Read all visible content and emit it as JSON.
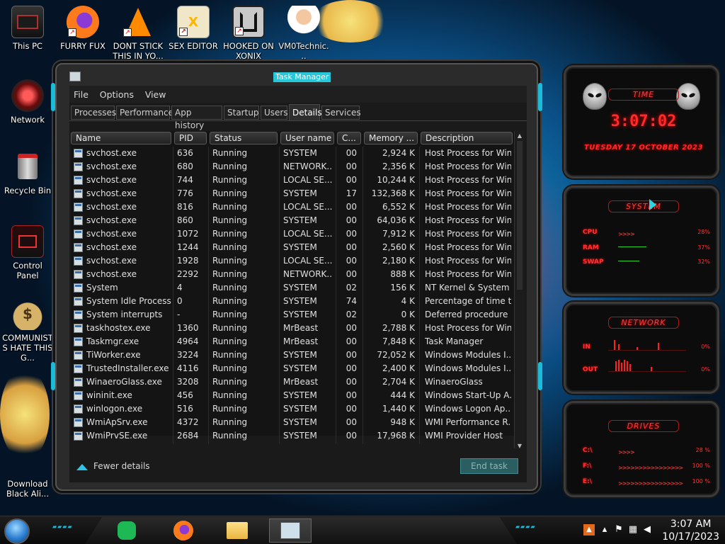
{
  "desktop": {
    "icons": [
      {
        "label": "This PC"
      },
      {
        "label": "FURRY FUX"
      },
      {
        "label": "DONT STICK THIS IN YO..."
      },
      {
        "label": "SEX EDITOR"
      },
      {
        "label": "HOOKED ON XONIX"
      },
      {
        "label": "VM0Technic..."
      },
      {
        "label": "Network"
      },
      {
        "label": "Recycle Bin"
      },
      {
        "label": "Control Panel"
      },
      {
        "label": "COMMUNISTS HATE THIS G..."
      },
      {
        "label": "Download Black Ali..."
      }
    ]
  },
  "task_manager": {
    "title": "Task Manager",
    "menu": [
      "File",
      "Options",
      "View"
    ],
    "tabs": [
      "Processes",
      "Performance",
      "App history",
      "Startup",
      "Users",
      "Details",
      "Services"
    ],
    "active_tab": "Details",
    "columns": [
      "Name",
      "PID",
      "Status",
      "User name",
      "C...",
      "Memory ...",
      "Description"
    ],
    "rows": [
      [
        "svchost.exe",
        "636",
        "Running",
        "SYSTEM",
        "00",
        "2,924 K",
        "Host Process for Win..."
      ],
      [
        "svchost.exe",
        "680",
        "Running",
        "NETWORK...",
        "00",
        "2,356 K",
        "Host Process for Win..."
      ],
      [
        "svchost.exe",
        "744",
        "Running",
        "LOCAL SE...",
        "00",
        "10,244 K",
        "Host Process for Win..."
      ],
      [
        "svchost.exe",
        "776",
        "Running",
        "SYSTEM",
        "17",
        "132,368 K",
        "Host Process for Win..."
      ],
      [
        "svchost.exe",
        "816",
        "Running",
        "LOCAL SE...",
        "00",
        "6,552 K",
        "Host Process for Win..."
      ],
      [
        "svchost.exe",
        "860",
        "Running",
        "SYSTEM",
        "00",
        "64,036 K",
        "Host Process for Win..."
      ],
      [
        "svchost.exe",
        "1072",
        "Running",
        "LOCAL SE...",
        "00",
        "7,912 K",
        "Host Process for Win..."
      ],
      [
        "svchost.exe",
        "1244",
        "Running",
        "SYSTEM",
        "00",
        "2,560 K",
        "Host Process for Win..."
      ],
      [
        "svchost.exe",
        "1928",
        "Running",
        "LOCAL SE...",
        "00",
        "2,180 K",
        "Host Process for Win..."
      ],
      [
        "svchost.exe",
        "2292",
        "Running",
        "NETWORK...",
        "00",
        "888 K",
        "Host Process for Win..."
      ],
      [
        "System",
        "4",
        "Running",
        "SYSTEM",
        "02",
        "156 K",
        "NT Kernel & System"
      ],
      [
        "System Idle Process",
        "0",
        "Running",
        "SYSTEM",
        "74",
        "4 K",
        "Percentage of time t..."
      ],
      [
        "System interrupts",
        "-",
        "Running",
        "SYSTEM",
        "02",
        "0 K",
        "Deferred procedure ..."
      ],
      [
        "taskhostex.exe",
        "1360",
        "Running",
        "MrBeast",
        "00",
        "2,788 K",
        "Host Process for Win..."
      ],
      [
        "Taskmgr.exe",
        "4964",
        "Running",
        "MrBeast",
        "00",
        "7,848 K",
        "Task Manager"
      ],
      [
        "TiWorker.exe",
        "3224",
        "Running",
        "SYSTEM",
        "00",
        "72,052 K",
        "Windows Modules I..."
      ],
      [
        "TrustedInstaller.exe",
        "4116",
        "Running",
        "SYSTEM",
        "00",
        "2,400 K",
        "Windows Modules I..."
      ],
      [
        "WinaeroGlass.exe",
        "3208",
        "Running",
        "MrBeast",
        "00",
        "2,704 K",
        "WinaeroGlass"
      ],
      [
        "wininit.exe",
        "456",
        "Running",
        "SYSTEM",
        "00",
        "444 K",
        "Windows Start-Up A..."
      ],
      [
        "winlogon.exe",
        "516",
        "Running",
        "SYSTEM",
        "00",
        "1,440 K",
        "Windows Logon Ap..."
      ],
      [
        "WmiApSrv.exe",
        "4372",
        "Running",
        "SYSTEM",
        "00",
        "948 K",
        "WMI Performance R..."
      ],
      [
        "WmiPrvSE.exe",
        "2684",
        "Running",
        "SYSTEM",
        "00",
        "17,968 K",
        "WMI Provider Host"
      ]
    ],
    "fewer_details": "Fewer details",
    "end_task": "End task"
  },
  "gadgets": {
    "time": {
      "title": "TIME",
      "clock": "3:07:02",
      "date": "TUESDAY 17 OCTOBER 2023"
    },
    "system": {
      "title": "SYSTEM",
      "cpu_label": "CPU",
      "cpu_value": "28%",
      "cpu_level": 0.28,
      "ram_label": "RAM",
      "ram_value": "37%",
      "ram_level": 0.37,
      "swap_label": "SWAP",
      "swap_value": "32%",
      "swap_level": 0.32
    },
    "network": {
      "title": "NETWORK",
      "in_label": "IN",
      "in_value": "0%",
      "out_label": "OUT",
      "out_value": "0%"
    },
    "drives": {
      "title": "DRIVES",
      "items": [
        {
          "label": "C:\\",
          "value": "28 %",
          "level": 0.28
        },
        {
          "label": "F:\\",
          "value": "100 %",
          "level": 1.0
        },
        {
          "label": "E:\\",
          "value": "100 %",
          "level": 1.0
        }
      ]
    }
  },
  "taskbar": {
    "time": "3:07 AM",
    "date": "10/17/2023"
  },
  "colors": {
    "accent_cyan": "#1bbcd8",
    "gadget_red": "#ff2a2a",
    "end_task_bg": "#2a5e60"
  }
}
